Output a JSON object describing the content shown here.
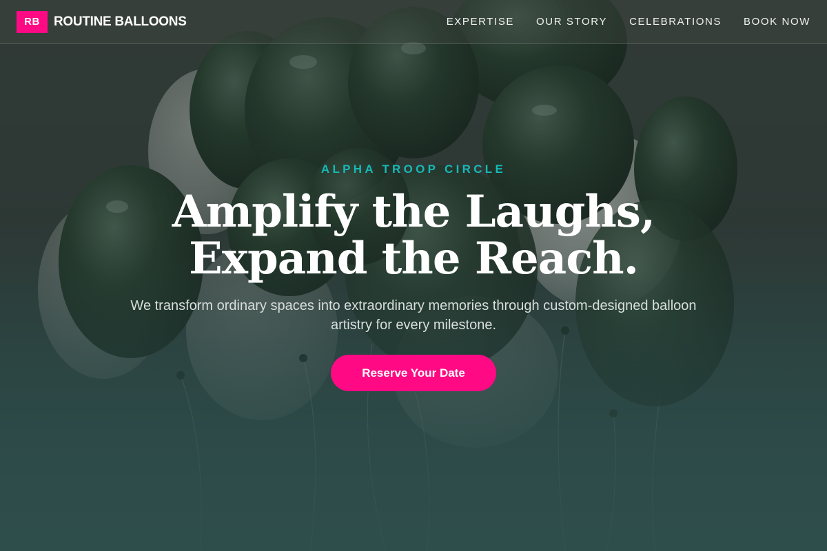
{
  "navbar": {
    "logo_badge": "RB",
    "brand_name": "ROUTINE BALLOONS",
    "links": [
      "EXPERTISE",
      "OUR STORY",
      "CELEBRATIONS",
      "BOOK NOW"
    ]
  },
  "hero": {
    "eyebrow": "ALPHA TROOP CIRCLE",
    "headline_line1": "Amplify the Laughs,",
    "headline_line2": "Expand the Reach.",
    "subtext": "We transform ordinary spaces into extraordinary memories through custom-designed balloon artistry for every milestone.",
    "cta_label": "Reserve Your Date"
  },
  "colors": {
    "accent_pink": "#ff0a84",
    "eyebrow_teal": "#17b9b6",
    "balloon_green": "#1f3a2c",
    "balloon_white": "#c9cfcb"
  }
}
